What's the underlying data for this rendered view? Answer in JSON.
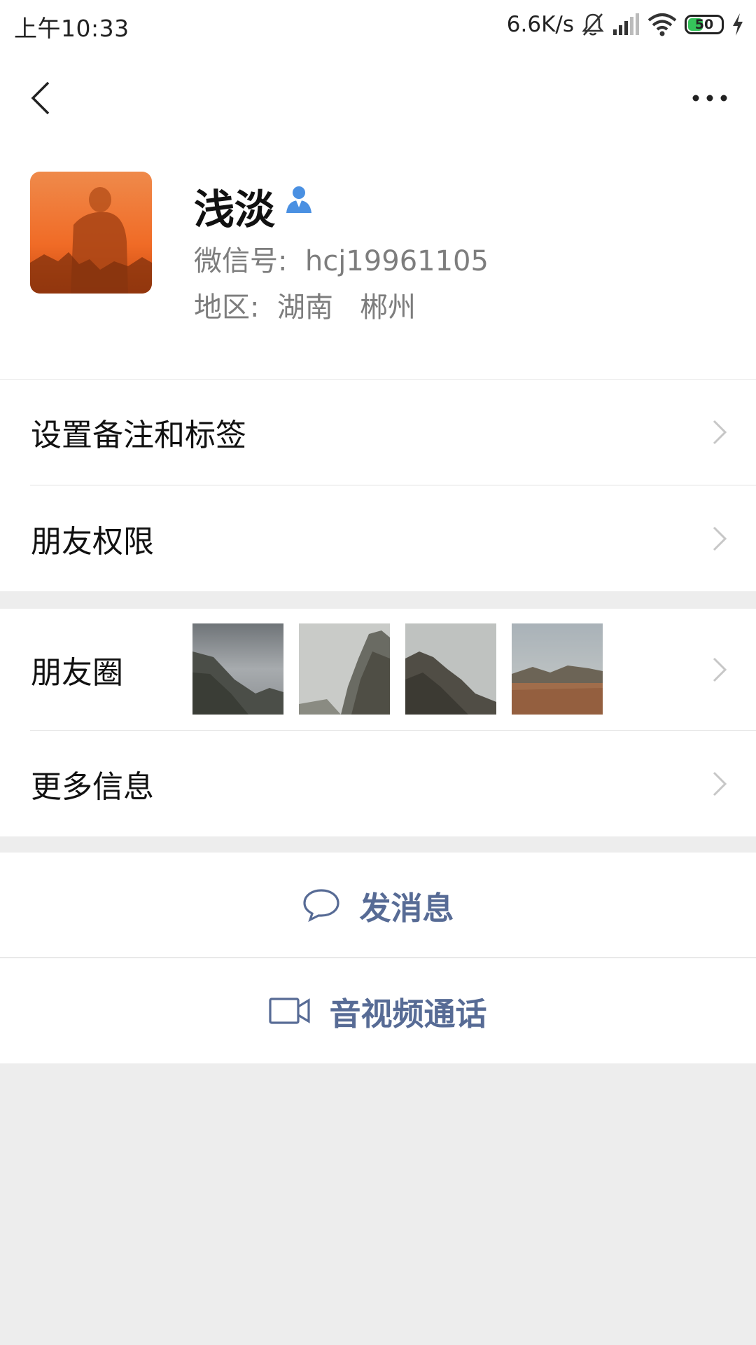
{
  "status_bar": {
    "time": "上午10:33",
    "net_speed": "6.6K/s",
    "battery_level": "50",
    "battery_fraction": 0.5,
    "icons": [
      "bell-muted-icon",
      "signal-icon",
      "wifi-icon",
      "battery-icon",
      "charging-icon"
    ]
  },
  "nav": {
    "back_icon": "chevron-left-icon",
    "more_icon": "more-dots-icon"
  },
  "profile": {
    "name": "浅淡",
    "contact_icon": "contact-person-icon",
    "wechat_id": "微信号:  hcj19961105",
    "region": "地区:  湖南   郴州"
  },
  "rows": {
    "remark": "设置备注和标签",
    "permissions": "朋友权限",
    "moments": "朋友圈",
    "more_info": "更多信息"
  },
  "actions": {
    "send_message": "发消息",
    "call": "音视频通话"
  },
  "colors": {
    "link_blue": "#576b95",
    "contact_icon_blue": "#4a90e2",
    "background": "#ededed"
  }
}
